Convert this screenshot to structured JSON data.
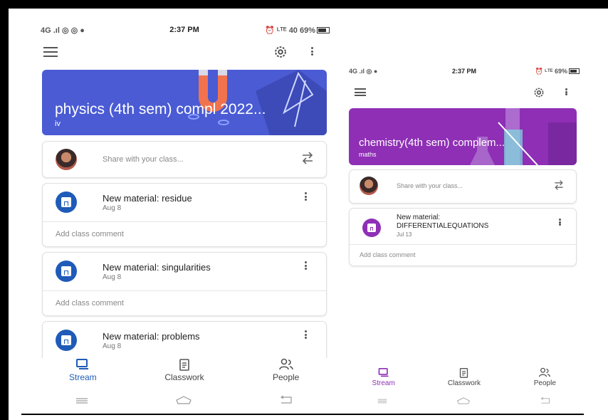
{
  "left_phone": {
    "status": {
      "left": "4G .ıl ◎ ◎ ●",
      "time": "2:37 PM",
      "right": "⏰ ᴸᵀᴱ 40 69%"
    },
    "banner": {
      "title": "physics (4th sem) compl 2022...",
      "subtitle": "iv"
    },
    "share_placeholder": "Share with your class...",
    "posts": [
      {
        "title": "New material: residue",
        "date": "Aug 8",
        "comment": "Add class comment"
      },
      {
        "title": "New material: singularities",
        "date": "Aug 8",
        "comment": "Add class comment"
      },
      {
        "title": "New material: problems",
        "date": "Aug 8"
      }
    ],
    "nav": [
      {
        "label": "Stream",
        "icon": "stream-icon"
      },
      {
        "label": "Classwork",
        "icon": "classwork-icon"
      },
      {
        "label": "People",
        "icon": "people-icon"
      }
    ]
  },
  "right_phone": {
    "status": {
      "left": "4G .ıl ◎ ●",
      "time": "2:37 PM",
      "right": "⏰ ᴸᵀᴱ 69%"
    },
    "banner": {
      "title": "chemistry(4th sem) complem...",
      "subtitle": "maths"
    },
    "share_placeholder": "Share with your class...",
    "posts": [
      {
        "title_line1": "New material:",
        "title_line2": "DIFFERENTIALEQUATIONS",
        "date": "Jul 13",
        "comment": "Add class comment"
      }
    ],
    "nav": [
      {
        "label": "Stream",
        "icon": "stream-icon"
      },
      {
        "label": "Classwork",
        "icon": "classwork-icon"
      },
      {
        "label": "People",
        "icon": "people-icon"
      }
    ]
  },
  "colors": {
    "physics_banner": "#4a5bd4",
    "chemistry_banner": "#8e2fb5",
    "physics_accent": "#1f5bb8",
    "chemistry_accent": "#8e2fb5"
  }
}
